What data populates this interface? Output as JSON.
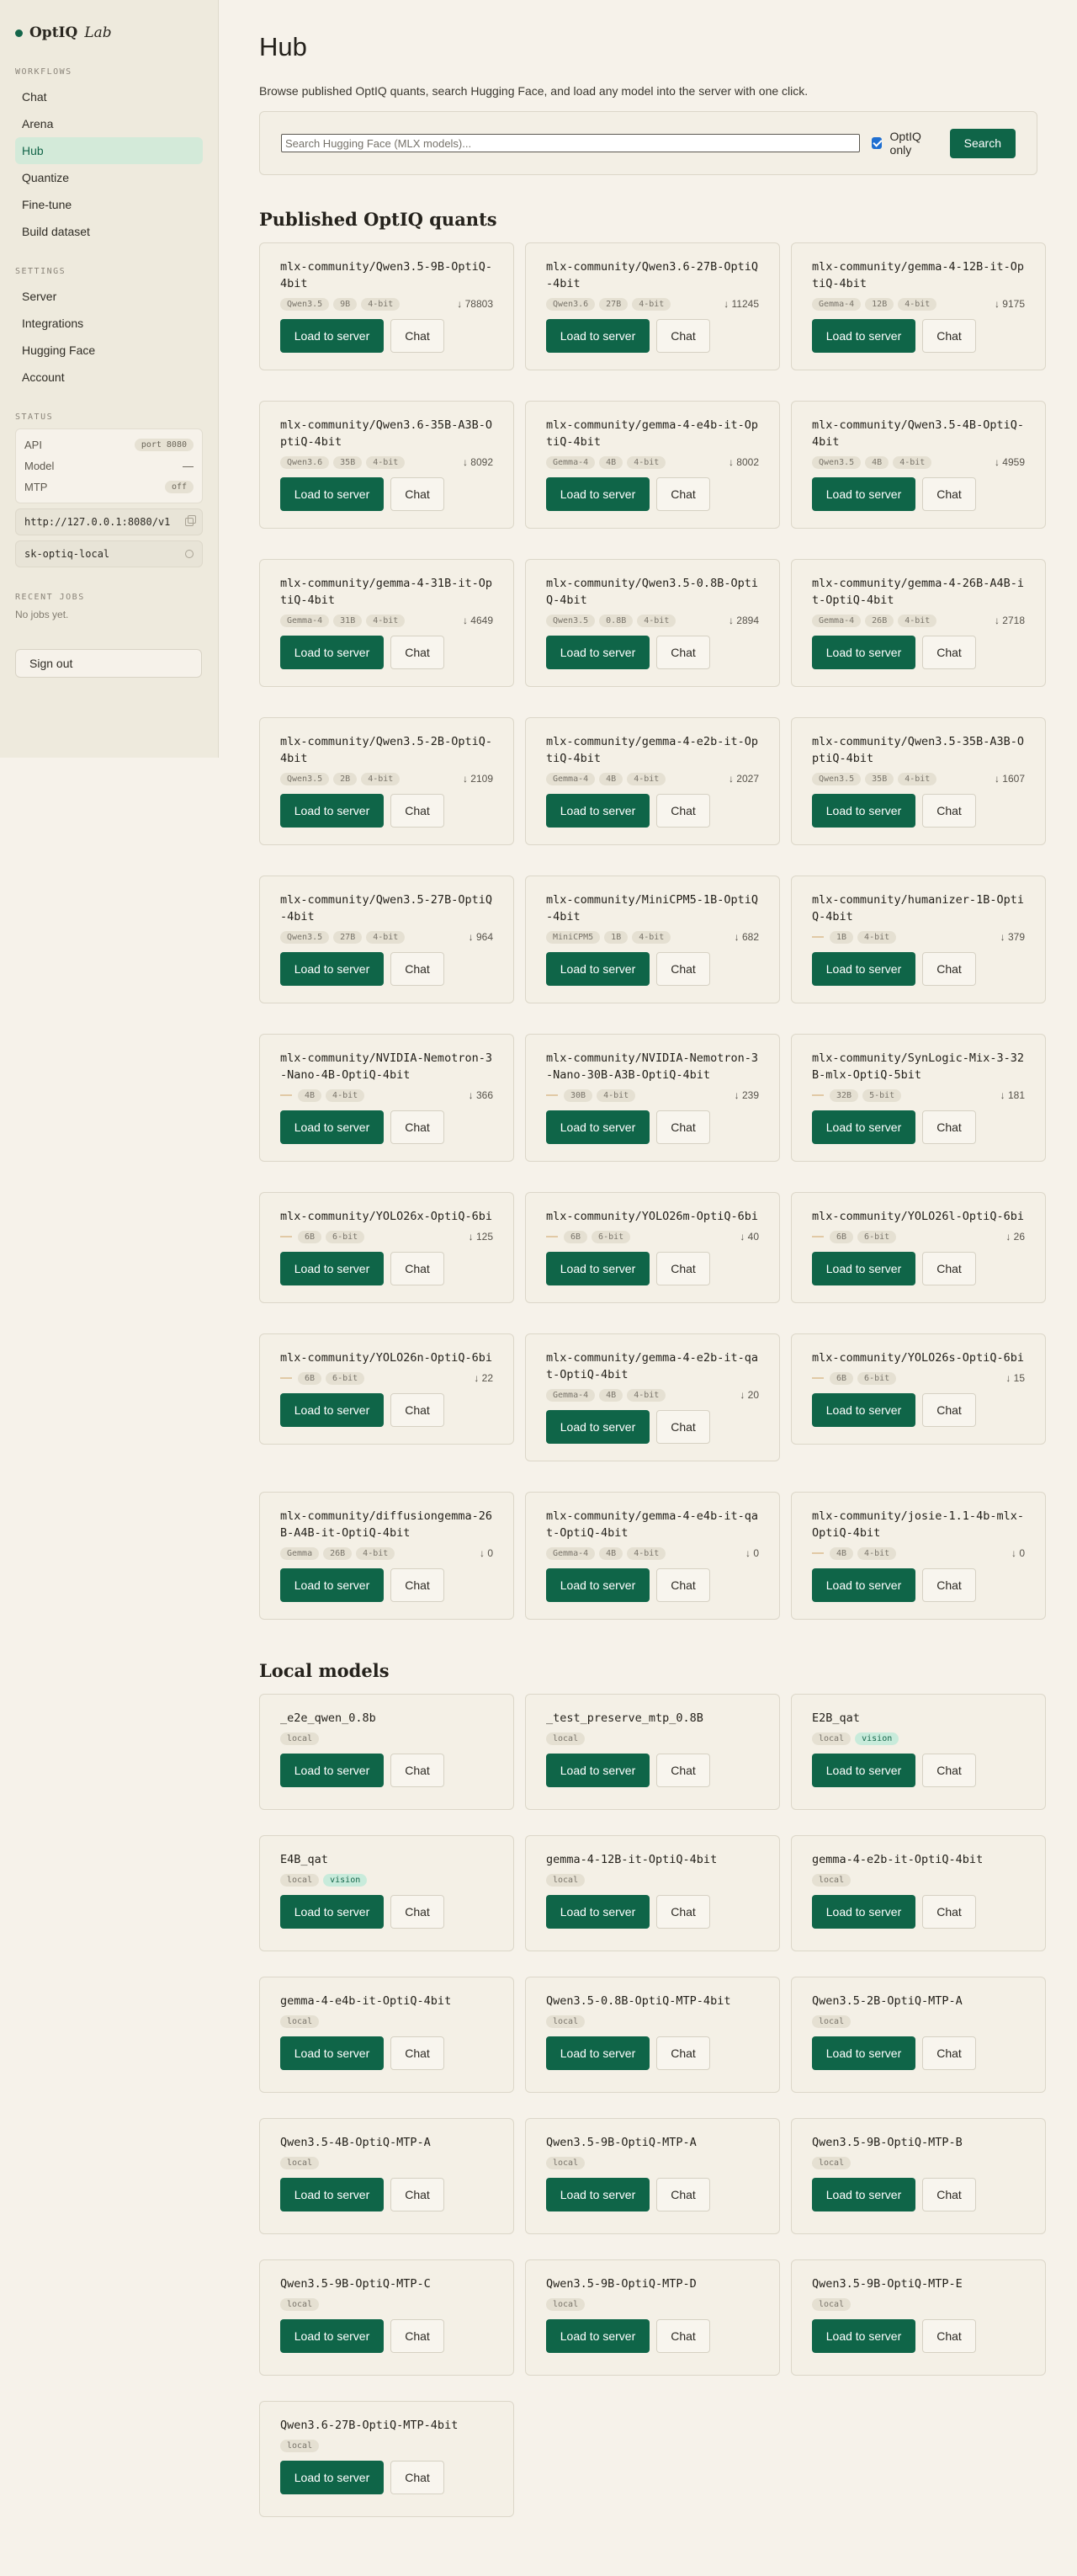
{
  "brand": {
    "name": "OptIQ",
    "sub": "Lab"
  },
  "sidebar": {
    "workflows_title": "WORKFLOWS",
    "workflows": [
      {
        "label": "Chat",
        "id": "chat"
      },
      {
        "label": "Arena",
        "id": "arena"
      },
      {
        "label": "Hub",
        "id": "hub",
        "active": true
      },
      {
        "label": "Quantize",
        "id": "quantize"
      },
      {
        "label": "Fine-tune",
        "id": "fine-tune"
      },
      {
        "label": "Build dataset",
        "id": "build-dataset"
      }
    ],
    "settings_title": "SETTINGS",
    "settings": [
      {
        "label": "Server",
        "id": "server"
      },
      {
        "label": "Integrations",
        "id": "integrations"
      },
      {
        "label": "Hugging Face",
        "id": "hugging-face"
      },
      {
        "label": "Account",
        "id": "account"
      }
    ],
    "status_title": "STATUS",
    "status": [
      {
        "label": "API",
        "value": "port 8080",
        "pill": true
      },
      {
        "label": "Model",
        "value": "—",
        "pill": false
      },
      {
        "label": "MTP",
        "value": "off",
        "pill": true
      }
    ],
    "api_url": "http://127.0.0.1:8080/v1",
    "api_key": "sk-optiq-local",
    "jobs_title": "RECENT JOBS",
    "jobs_empty": "No jobs yet.",
    "sign_out": "Sign out"
  },
  "header": {
    "title": "Hub",
    "description": "Browse published OptIQ quants, search Hugging Face, and load any model into the server with one click."
  },
  "search": {
    "placeholder": "Search Hugging Face (MLX models)...",
    "value": "",
    "optiq_only_label": "OptIQ only",
    "optiq_only": true,
    "button_label": "Search"
  },
  "labels": {
    "load": "Load to server",
    "chat": "Chat"
  },
  "published_title": "Published OptIQ quants",
  "published": [
    {
      "name": "mlx-community/Qwen3.5-9B-OptiQ-4bit",
      "family": "Qwen3.5",
      "size": "9B",
      "bits": "4-bit",
      "downloads": "↓ 78803"
    },
    {
      "name": "mlx-community/Qwen3.6-27B-OptiQ-4bit",
      "family": "Qwen3.6",
      "size": "27B",
      "bits": "4-bit",
      "downloads": "↓ 11245"
    },
    {
      "name": "mlx-community/gemma-4-12B-it-OptiQ-4bit",
      "family": "Gemma-4",
      "size": "12B",
      "bits": "4-bit",
      "downloads": "↓ 9175"
    },
    {
      "name": "mlx-community/Qwen3.6-35B-A3B-OptiQ-4bit",
      "family": "Qwen3.6",
      "size": "35B",
      "bits": "4-bit",
      "downloads": "↓ 8092"
    },
    {
      "name": "mlx-community/gemma-4-e4b-it-OptiQ-4bit",
      "family": "Gemma-4",
      "size": "4B",
      "bits": "4-bit",
      "downloads": "↓ 8002"
    },
    {
      "name": "mlx-community/Qwen3.5-4B-OptiQ-4bit",
      "family": "Qwen3.5",
      "size": "4B",
      "bits": "4-bit",
      "downloads": "↓ 4959"
    },
    {
      "name": "mlx-community/gemma-4-31B-it-OptiQ-4bit",
      "family": "Gemma-4",
      "size": "31B",
      "bits": "4-bit",
      "downloads": "↓ 4649"
    },
    {
      "name": "mlx-community/Qwen3.5-0.8B-OptiQ-4bit",
      "family": "Qwen3.5",
      "size": "0.8B",
      "bits": "4-bit",
      "downloads": "↓ 2894"
    },
    {
      "name": "mlx-community/gemma-4-26B-A4B-it-OptiQ-4bit",
      "family": "Gemma-4",
      "size": "26B",
      "bits": "4-bit",
      "downloads": "↓ 2718"
    },
    {
      "name": "mlx-community/Qwen3.5-2B-OptiQ-4bit",
      "family": "Qwen3.5",
      "size": "2B",
      "bits": "4-bit",
      "downloads": "↓ 2109"
    },
    {
      "name": "mlx-community/gemma-4-e2b-it-OptiQ-4bit",
      "family": "Gemma-4",
      "size": "4B",
      "bits": "4-bit",
      "downloads": "↓ 2027"
    },
    {
      "name": "mlx-community/Qwen3.5-35B-A3B-OptiQ-4bit",
      "family": "Qwen3.5",
      "size": "35B",
      "bits": "4-bit",
      "downloads": "↓ 1607"
    },
    {
      "name": "mlx-community/Qwen3.5-27B-OptiQ-4bit",
      "family": "Qwen3.5",
      "size": "27B",
      "bits": "4-bit",
      "downloads": "↓ 964"
    },
    {
      "name": "mlx-community/MiniCPM5-1B-OptiQ-4bit",
      "family": "MiniCPM5",
      "size": "1B",
      "bits": "4-bit",
      "downloads": "↓ 682"
    },
    {
      "name": "mlx-community/humanizer-1B-OptiQ-4bit",
      "family": "",
      "size": "1B",
      "bits": "4-bit",
      "downloads": "↓ 379"
    },
    {
      "name": "mlx-community/NVIDIA-Nemotron-3-Nano-4B-OptiQ-4bit",
      "family": "",
      "size": "4B",
      "bits": "4-bit",
      "downloads": "↓ 366"
    },
    {
      "name": "mlx-community/NVIDIA-Nemotron-3-Nano-30B-A3B-OptiQ-4bit",
      "family": "",
      "size": "30B",
      "bits": "4-bit",
      "downloads": "↓ 239"
    },
    {
      "name": "mlx-community/SynLogic-Mix-3-32B-mlx-OptiQ-5bit",
      "family": "",
      "size": "32B",
      "bits": "5-bit",
      "downloads": "↓ 181"
    },
    {
      "name": "mlx-community/YOLO26x-OptiQ-6bit",
      "family": "",
      "size": "6B",
      "bits": "6-bit",
      "downloads": "↓ 125"
    },
    {
      "name": "mlx-community/YOLO26m-OptiQ-6bit",
      "family": "",
      "size": "6B",
      "bits": "6-bit",
      "downloads": "↓ 40"
    },
    {
      "name": "mlx-community/YOLO26l-OptiQ-6bit",
      "family": "",
      "size": "6B",
      "bits": "6-bit",
      "downloads": "↓ 26"
    },
    {
      "name": "mlx-community/YOLO26n-OptiQ-6bit",
      "family": "",
      "size": "6B",
      "bits": "6-bit",
      "downloads": "↓ 22"
    },
    {
      "name": "mlx-community/gemma-4-e2b-it-qat-OptiQ-4bit",
      "family": "Gemma-4",
      "size": "4B",
      "bits": "4-bit",
      "downloads": "↓ 20"
    },
    {
      "name": "mlx-community/YOLO26s-OptiQ-6bit",
      "family": "",
      "size": "6B",
      "bits": "6-bit",
      "downloads": "↓ 15"
    },
    {
      "name": "mlx-community/diffusiongemma-26B-A4B-it-OptiQ-4bit",
      "family": "Gemma",
      "size": "26B",
      "bits": "4-bit",
      "downloads": "↓ 0"
    },
    {
      "name": "mlx-community/gemma-4-e4b-it-qat-OptiQ-4bit",
      "family": "Gemma-4",
      "size": "4B",
      "bits": "4-bit",
      "downloads": "↓ 0"
    },
    {
      "name": "mlx-community/josie-1.1-4b-mlx-OptiQ-4bit",
      "family": "",
      "size": "4B",
      "bits": "4-bit",
      "downloads": "↓ 0"
    }
  ],
  "local_title": "Local models",
  "local": [
    {
      "name": "_e2e_qwen_0.8b",
      "tags": [
        "local"
      ]
    },
    {
      "name": "_test_preserve_mtp_0.8B",
      "tags": [
        "local"
      ]
    },
    {
      "name": "E2B_qat",
      "tags": [
        "local",
        "vision"
      ]
    },
    {
      "name": "E4B_qat",
      "tags": [
        "local",
        "vision"
      ]
    },
    {
      "name": "gemma-4-12B-it-OptiQ-4bit",
      "tags": [
        "local"
      ]
    },
    {
      "name": "gemma-4-e2b-it-OptiQ-4bit",
      "tags": [
        "local"
      ]
    },
    {
      "name": "gemma-4-e4b-it-OptiQ-4bit",
      "tags": [
        "local"
      ]
    },
    {
      "name": "Qwen3.5-0.8B-OptiQ-MTP-4bit",
      "tags": [
        "local"
      ]
    },
    {
      "name": "Qwen3.5-2B-OptiQ-MTP-A",
      "tags": [
        "local"
      ]
    },
    {
      "name": "Qwen3.5-4B-OptiQ-MTP-A",
      "tags": [
        "local"
      ]
    },
    {
      "name": "Qwen3.5-9B-OptiQ-MTP-A",
      "tags": [
        "local"
      ]
    },
    {
      "name": "Qwen3.5-9B-OptiQ-MTP-B",
      "tags": [
        "local"
      ]
    },
    {
      "name": "Qwen3.5-9B-OptiQ-MTP-C",
      "tags": [
        "local"
      ]
    },
    {
      "name": "Qwen3.5-9B-OptiQ-MTP-D",
      "tags": [
        "local"
      ]
    },
    {
      "name": "Qwen3.5-9B-OptiQ-MTP-E",
      "tags": [
        "local"
      ]
    },
    {
      "name": "Qwen3.6-27B-OptiQ-MTP-4bit",
      "tags": [
        "local"
      ]
    }
  ]
}
